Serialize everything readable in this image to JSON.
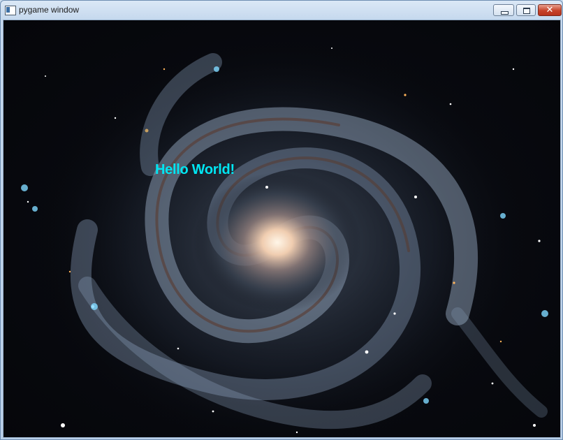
{
  "window": {
    "title": "pygame window",
    "controls": {
      "minimize": "minimize",
      "maximize": "maximize",
      "close": "close"
    }
  },
  "game": {
    "background": "spiral galaxy image",
    "text": "Hello World!",
    "text_color": "#00e6f2"
  }
}
